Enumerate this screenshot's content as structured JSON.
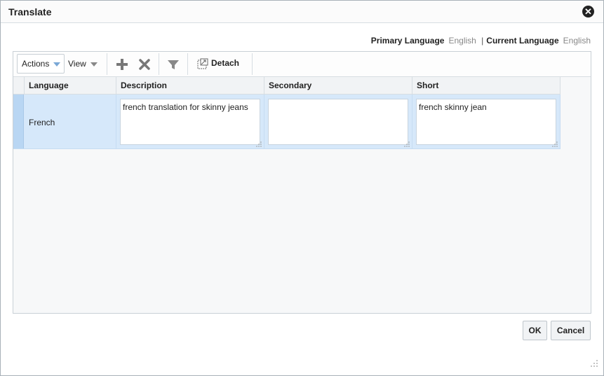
{
  "dialog": {
    "title": "Translate",
    "close_icon": "close-icon"
  },
  "language_bar": {
    "primary_label": "Primary Language",
    "primary_value": "English",
    "separator": "|",
    "current_label": "Current Language",
    "current_value": "English"
  },
  "toolbar": {
    "actions_label": "Actions",
    "view_label": "View",
    "add_icon": "add-icon",
    "delete_icon": "delete-icon",
    "filter_icon": "filter-icon",
    "detach_label": "Detach"
  },
  "table": {
    "columns": [
      "Language",
      "Description",
      "Secondary",
      "Short"
    ],
    "rows": [
      {
        "language": "French",
        "description": "french translation for skinny jeans",
        "secondary": "",
        "short": "french skinny jean"
      }
    ]
  },
  "footer": {
    "ok_label": "OK",
    "cancel_label": "Cancel"
  },
  "colors": {
    "selected_row": "#d6e8fa",
    "accent_caret": "#7aa8d6"
  }
}
